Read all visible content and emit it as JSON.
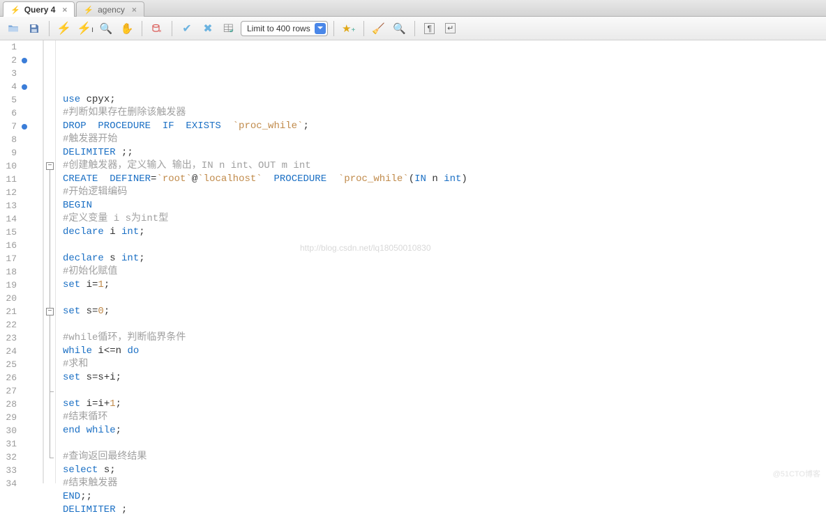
{
  "tabs": [
    {
      "label": "Query 4",
      "active": true
    },
    {
      "label": "agency",
      "active": false
    }
  ],
  "toolbar": {
    "limit_label": "Limit to 400 rows"
  },
  "editor": {
    "breakpoints": [
      2,
      4,
      7
    ],
    "fold_regions": [
      {
        "start": 10,
        "end": 32
      },
      {
        "start": 21,
        "end": 27
      }
    ],
    "lines": [
      {
        "n": 1,
        "tokens": []
      },
      {
        "n": 2,
        "tokens": [
          {
            "t": "use ",
            "c": "kw"
          },
          {
            "t": "cpyx",
            "c": "pu"
          },
          {
            "t": ";",
            "c": "pu"
          }
        ]
      },
      {
        "n": 3,
        "tokens": [
          {
            "t": "#判断如果存在删除该触发器",
            "c": "cm"
          }
        ]
      },
      {
        "n": 4,
        "tokens": [
          {
            "t": "DROP  PROCEDURE  IF  EXISTS  ",
            "c": "kw"
          },
          {
            "t": "`proc_while`",
            "c": "str"
          },
          {
            "t": ";",
            "c": "pu"
          }
        ]
      },
      {
        "n": 5,
        "tokens": [
          {
            "t": "#触发器开始",
            "c": "cm"
          }
        ]
      },
      {
        "n": 6,
        "tokens": [
          {
            "t": "DELIMITER ",
            "c": "kw"
          },
          {
            "t": ";;",
            "c": "pu"
          }
        ]
      },
      {
        "n": 7,
        "tokens": [
          {
            "t": "#创建触发器，定义输入 输出，IN n int、OUT m int",
            "c": "cm"
          }
        ]
      },
      {
        "n": 8,
        "tokens": [
          {
            "t": "CREATE  DEFINER",
            "c": "kw"
          },
          {
            "t": "=",
            "c": "pu"
          },
          {
            "t": "`root`",
            "c": "str"
          },
          {
            "t": "@",
            "c": "pu"
          },
          {
            "t": "`localhost`",
            "c": "str"
          },
          {
            "t": "  PROCEDURE  ",
            "c": "kw"
          },
          {
            "t": "`proc_while`",
            "c": "str"
          },
          {
            "t": "(",
            "c": "pu"
          },
          {
            "t": "IN ",
            "c": "kw"
          },
          {
            "t": "n ",
            "c": "pu"
          },
          {
            "t": "int",
            "c": "kw"
          },
          {
            "t": ")",
            "c": "pu"
          }
        ]
      },
      {
        "n": 9,
        "tokens": [
          {
            "t": "#开始逻辑编码",
            "c": "cm"
          }
        ]
      },
      {
        "n": 10,
        "tokens": [
          {
            "t": "BEGIN",
            "c": "kw"
          }
        ]
      },
      {
        "n": 11,
        "tokens": [
          {
            "t": "#定义变量 i s为int型",
            "c": "cm"
          }
        ]
      },
      {
        "n": 12,
        "tokens": [
          {
            "t": "declare ",
            "c": "kw"
          },
          {
            "t": "i ",
            "c": "pu"
          },
          {
            "t": "int",
            "c": "kw"
          },
          {
            "t": ";",
            "c": "pu"
          }
        ]
      },
      {
        "n": 13,
        "tokens": []
      },
      {
        "n": 14,
        "tokens": [
          {
            "t": "declare ",
            "c": "kw"
          },
          {
            "t": "s ",
            "c": "pu"
          },
          {
            "t": "int",
            "c": "kw"
          },
          {
            "t": ";",
            "c": "pu"
          }
        ]
      },
      {
        "n": 15,
        "tokens": [
          {
            "t": "#初始化赋值",
            "c": "cm"
          }
        ]
      },
      {
        "n": 16,
        "tokens": [
          {
            "t": "set ",
            "c": "kw"
          },
          {
            "t": "i",
            "c": "pu"
          },
          {
            "t": "=",
            "c": "pu"
          },
          {
            "t": "1",
            "c": "num2"
          },
          {
            "t": ";",
            "c": "pu"
          }
        ]
      },
      {
        "n": 17,
        "tokens": []
      },
      {
        "n": 18,
        "tokens": [
          {
            "t": "set ",
            "c": "kw"
          },
          {
            "t": "s",
            "c": "pu"
          },
          {
            "t": "=",
            "c": "pu"
          },
          {
            "t": "0",
            "c": "num2"
          },
          {
            "t": ";",
            "c": "pu"
          }
        ]
      },
      {
        "n": 19,
        "tokens": []
      },
      {
        "n": 20,
        "tokens": [
          {
            "t": "#while循环，判断临界条件",
            "c": "cm"
          }
        ]
      },
      {
        "n": 21,
        "tokens": [
          {
            "t": "while ",
            "c": "kw"
          },
          {
            "t": "i",
            "c": "pu"
          },
          {
            "t": "<=",
            "c": "pu"
          },
          {
            "t": "n ",
            "c": "pu"
          },
          {
            "t": "do",
            "c": "kw"
          }
        ]
      },
      {
        "n": 22,
        "tokens": [
          {
            "t": "#求和",
            "c": "cm"
          }
        ]
      },
      {
        "n": 23,
        "tokens": [
          {
            "t": "set ",
            "c": "kw"
          },
          {
            "t": "s",
            "c": "pu"
          },
          {
            "t": "=",
            "c": "pu"
          },
          {
            "t": "s",
            "c": "pu"
          },
          {
            "t": "+",
            "c": "pu"
          },
          {
            "t": "i",
            "c": "pu"
          },
          {
            "t": ";",
            "c": "pu"
          }
        ]
      },
      {
        "n": 24,
        "tokens": []
      },
      {
        "n": 25,
        "tokens": [
          {
            "t": "set ",
            "c": "kw"
          },
          {
            "t": "i",
            "c": "pu"
          },
          {
            "t": "=",
            "c": "pu"
          },
          {
            "t": "i",
            "c": "pu"
          },
          {
            "t": "+",
            "c": "pu"
          },
          {
            "t": "1",
            "c": "num2"
          },
          {
            "t": ";",
            "c": "pu"
          }
        ]
      },
      {
        "n": 26,
        "tokens": [
          {
            "t": "#结束循环",
            "c": "cm"
          }
        ]
      },
      {
        "n": 27,
        "tokens": [
          {
            "t": "end while",
            "c": "kw"
          },
          {
            "t": ";",
            "c": "pu"
          }
        ]
      },
      {
        "n": 28,
        "tokens": []
      },
      {
        "n": 29,
        "tokens": [
          {
            "t": "#查询返回最终结果",
            "c": "cm"
          }
        ]
      },
      {
        "n": 30,
        "tokens": [
          {
            "t": "select ",
            "c": "kw"
          },
          {
            "t": "s",
            "c": "pu"
          },
          {
            "t": ";",
            "c": "pu"
          }
        ]
      },
      {
        "n": 31,
        "tokens": [
          {
            "t": "#结束触发器",
            "c": "cm"
          }
        ]
      },
      {
        "n": 32,
        "tokens": [
          {
            "t": "END",
            "c": "kw"
          },
          {
            "t": ";;",
            "c": "pu"
          }
        ]
      },
      {
        "n": 33,
        "tokens": [
          {
            "t": "DELIMITER ",
            "c": "kw"
          },
          {
            "t": ";",
            "c": "pu"
          }
        ]
      },
      {
        "n": 34,
        "tokens": []
      }
    ]
  },
  "watermark": "http://blog.csdn.net/lq18050010830",
  "corner_mark": "@51CTO博客"
}
